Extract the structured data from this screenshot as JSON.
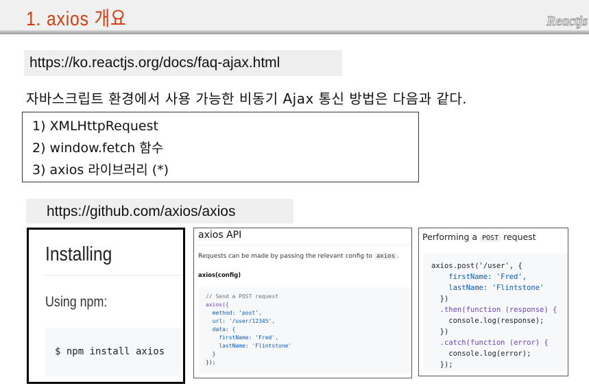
{
  "header": {
    "title": "1. axios 개요",
    "brand": "Reactjs"
  },
  "links": {
    "docs_url": "https://ko.reactjs.org/docs/faq-ajax.html",
    "github_url": "https://github.com/axios/axios"
  },
  "intro": "자바스크립트 환경에서 사용 가능한 비동기 Ajax 통신 방법은 다음과 같다.",
  "methods": [
    "1) XMLHttpRequest",
    "2) window.fetch 함수",
    "3) axios 라이브러리 (*)"
  ],
  "install_shot": {
    "heading": "Installing",
    "subheading": "Using npm:",
    "command": "$ npm install axios"
  },
  "api_shot": {
    "heading": "axios API",
    "text": "Requests can be made by passing the relevant config to",
    "inline_code": "axios",
    "text_end": ".",
    "subheading": "axios(config)",
    "code": [
      "// Send a POST request",
      "axios({",
      "  method: 'post',",
      "  url: '/user/12345',",
      "  data: {",
      "    firstName: 'Fred',",
      "    lastName: 'Flintstone'",
      "  }",
      "});"
    ]
  },
  "post_shot": {
    "heading_pre": "Performing a",
    "inline_code": "POST",
    "heading_post": "request",
    "code": [
      "axios.post('/user', {",
      "    firstName: 'Fred',",
      "    lastName: 'Flintstone'",
      "  })",
      "  .then(function (response) {",
      "    console.log(response);",
      "  })",
      "  .catch(function (error) {",
      "    console.log(error);",
      "  });"
    ]
  }
}
